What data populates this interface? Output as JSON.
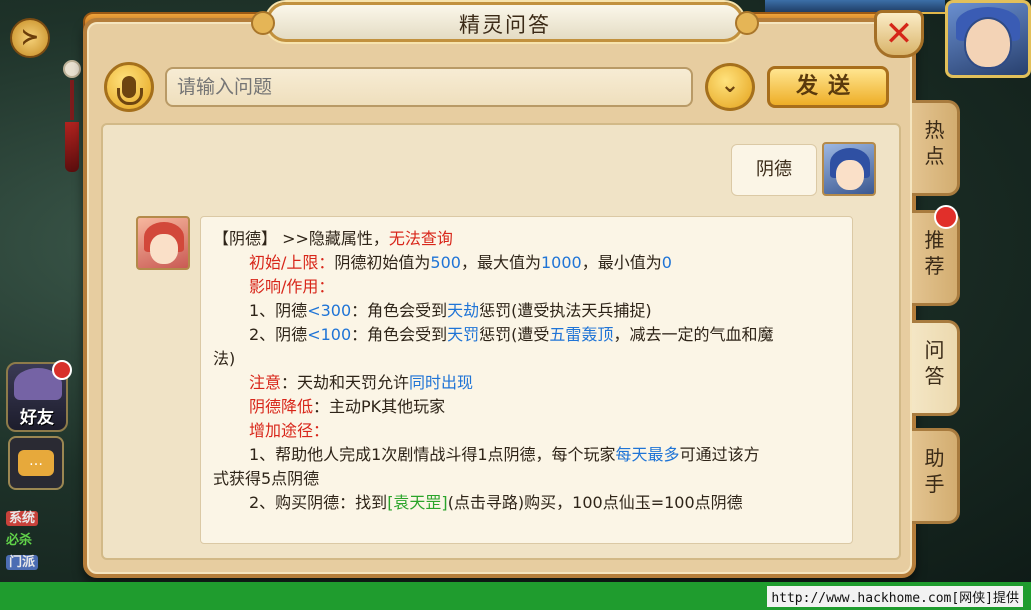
{
  "dialog": {
    "title": "精灵问答"
  },
  "input": {
    "placeholder": "请输入问题",
    "send_label": "发送"
  },
  "conversation": {
    "user_message": "阴德"
  },
  "answer": {
    "l1": {
      "a": "【阴德】 >>隐藏属性，",
      "b": "无法查询"
    },
    "l2": {
      "a": "初始/上限：",
      "b": "阴德初始值为",
      "c": "500",
      "d": "，最大值为",
      "e": "1000",
      "f": "，最小值为",
      "g": "0"
    },
    "l3": {
      "a": "影响/作用："
    },
    "l4": {
      "a": "1、阴德",
      "b": "<300",
      "c": "：角色会受到",
      "d": "天劫",
      "e": "惩罚(遭受执法天兵捕捉)"
    },
    "l5": {
      "a": "2、阴德",
      "b": "<100",
      "c": "：角色会受到",
      "d": "天罚",
      "e": "惩罚(遭受",
      "f": "五雷轰顶",
      "g": "，减去一定的气血和魔"
    },
    "l6": {
      "a": "法)"
    },
    "l7": {
      "a": "注意",
      "b": "：天劫和天罚允许",
      "c": "同时出现"
    },
    "l8": {
      "a": "阴德降低",
      "b": "：主动PK其他玩家"
    },
    "l9": {
      "a": "增加途径："
    },
    "l10": {
      "a": "1、帮助他人完成1次剧情战斗得1点阴德，每个玩家",
      "b": "每天最多",
      "c": "可通过该方"
    },
    "l11": {
      "a": "式获得5点阴德"
    },
    "l12": {
      "a": "2、购买阴德：找到",
      "b": "[袁天罡]",
      "c": "(点击寻路)购买，100点仙玉=100点阴德"
    }
  },
  "tabs": [
    "热点",
    "推荐",
    "问答",
    "助手"
  ],
  "background": {
    "friends_label": "好友",
    "chat_channels": [
      "系统",
      "必杀",
      "门派"
    ]
  },
  "footer": {
    "credit": "http://www.hackhome.com[网侠]提供"
  },
  "colors": {
    "accent": "#e4a21c",
    "highlight_red": "#d8261a",
    "highlight_blue": "#1f74d6",
    "link_green": "#2aa42a"
  }
}
